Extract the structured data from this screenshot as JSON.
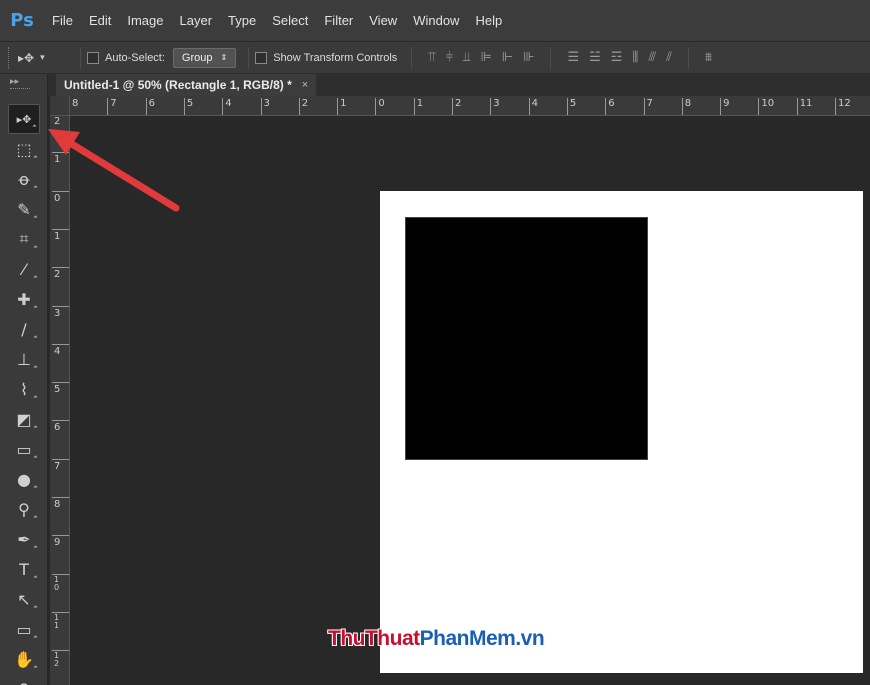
{
  "app": {
    "logo": "Ps",
    "menu": [
      "File",
      "Edit",
      "Image",
      "Layer",
      "Type",
      "Select",
      "Filter",
      "View",
      "Window",
      "Help"
    ]
  },
  "options": {
    "auto_select_label": "Auto-Select:",
    "auto_select_value": "Group",
    "show_transform_label": "Show Transform Controls"
  },
  "document": {
    "tab_title": "Untitled-1 @ 50% (Rectangle 1, RGB/8) *",
    "tab_close": "×",
    "canvas_color": "#ffffff",
    "rect_color": "#000000"
  },
  "rulers": {
    "top": [
      "8",
      "7",
      "6",
      "5",
      "4",
      "3",
      "2",
      "1",
      "0",
      "1",
      "2",
      "3",
      "4",
      "5",
      "6",
      "7",
      "8",
      "9",
      "10",
      "11",
      "12"
    ],
    "left": [
      "2",
      "1",
      "0",
      "1",
      "2",
      "3",
      "4",
      "5",
      "6",
      "7",
      "8",
      "9",
      "10",
      "11",
      "12"
    ]
  },
  "tools": [
    {
      "name": "move-tool",
      "glyph": "▸✥",
      "active": true
    },
    {
      "name": "marquee-tool",
      "glyph": "⬚"
    },
    {
      "name": "lasso-tool",
      "glyph": "ꝋ"
    },
    {
      "name": "quick-select-tool",
      "glyph": "✎"
    },
    {
      "name": "crop-tool",
      "glyph": "⌗"
    },
    {
      "name": "eyedropper-tool",
      "glyph": "⁄"
    },
    {
      "name": "healing-brush-tool",
      "glyph": "✚"
    },
    {
      "name": "brush-tool",
      "glyph": "∕"
    },
    {
      "name": "clone-stamp-tool",
      "glyph": "⊥"
    },
    {
      "name": "history-brush-tool",
      "glyph": "⌇"
    },
    {
      "name": "eraser-tool",
      "glyph": "◩"
    },
    {
      "name": "gradient-tool",
      "glyph": "▭"
    },
    {
      "name": "blur-tool",
      "glyph": "●"
    },
    {
      "name": "dodge-tool",
      "glyph": "⚲"
    },
    {
      "name": "pen-tool",
      "glyph": "✒"
    },
    {
      "name": "type-tool",
      "glyph": "T"
    },
    {
      "name": "path-select-tool",
      "glyph": "↖"
    },
    {
      "name": "shape-tool",
      "glyph": "▭"
    },
    {
      "name": "hand-tool",
      "glyph": "✋"
    },
    {
      "name": "zoom-tool",
      "glyph": "⚲"
    }
  ],
  "watermark": {
    "part1": "ThuThuat",
    "part2": "PhanMem.vn"
  }
}
